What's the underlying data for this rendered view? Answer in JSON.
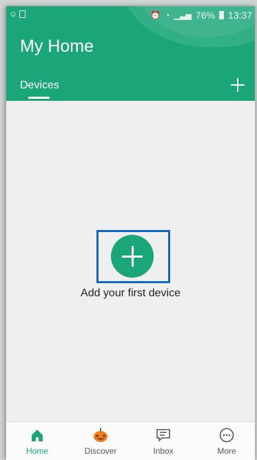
{
  "status_bar": {
    "battery": "76%",
    "time": "13:37"
  },
  "header": {
    "title": "My Home",
    "tab_devices": "Devices"
  },
  "main": {
    "add_first_device_label": "Add your first device"
  },
  "bottom_nav": {
    "items": [
      {
        "label": "Home",
        "icon": "home-icon",
        "active": true
      },
      {
        "label": "Discover",
        "icon": "pumpkin-icon",
        "active": false
      },
      {
        "label": "Inbox",
        "icon": "message-icon",
        "active": false
      },
      {
        "label": "More",
        "icon": "more-icon",
        "active": false
      }
    ]
  },
  "colors": {
    "accent": "#1ba67a",
    "highlight_border": "#1266c1",
    "background": "#efefef"
  }
}
